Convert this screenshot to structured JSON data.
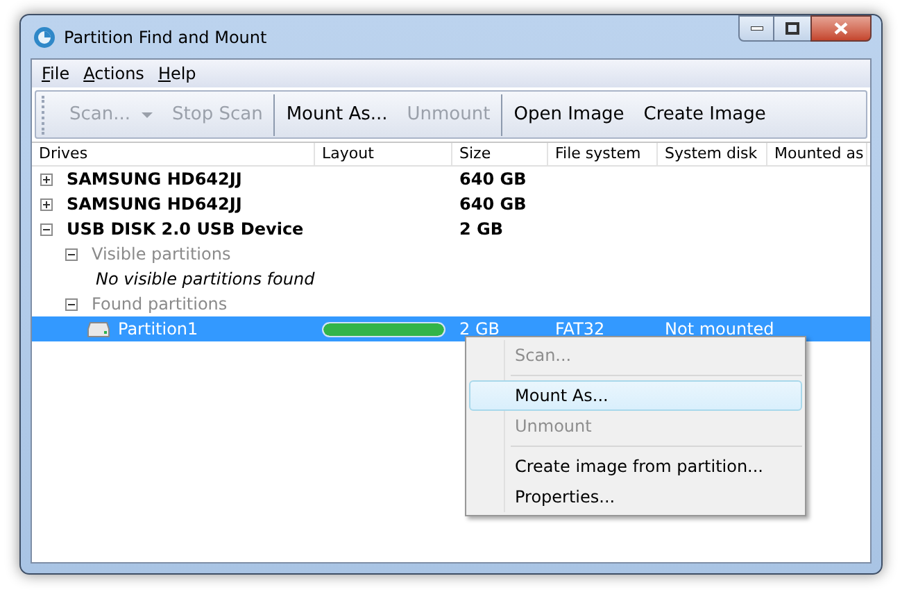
{
  "window": {
    "title": "Partition Find and Mount"
  },
  "menu": [
    {
      "label": "File"
    },
    {
      "label": "Actions"
    },
    {
      "label": "Help"
    }
  ],
  "toolbar": [
    [
      {
        "label": "Scan...",
        "disabled": true,
        "dropdown": true
      },
      {
        "label": "Stop Scan",
        "disabled": true,
        "dropdown": false
      }
    ],
    [
      {
        "label": "Mount As...",
        "disabled": false,
        "dropdown": false
      },
      {
        "label": "Unmount",
        "disabled": true,
        "dropdown": false
      }
    ],
    [
      {
        "label": "Open Image",
        "disabled": false,
        "dropdown": false
      },
      {
        "label": "Create Image",
        "disabled": false,
        "dropdown": false
      }
    ]
  ],
  "table": {
    "columns": [
      "Drives",
      "Layout",
      "Size",
      "File system",
      "System disk",
      "Mounted as"
    ],
    "rows": [
      {
        "kind": "drive",
        "name": "SAMSUNG HD642JJ",
        "size": "640 GB",
        "expanded": false,
        "selected": false
      },
      {
        "kind": "drive",
        "name": "SAMSUNG HD642JJ",
        "size": "640 GB",
        "expanded": false,
        "selected": false
      },
      {
        "kind": "drive",
        "name": "USB DISK 2.0 USB Device",
        "size": "2 GB",
        "expanded": true,
        "selected": false,
        "children": [
          {
            "kind": "group",
            "name": "Visible partitions",
            "expanded": true,
            "children": [
              {
                "kind": "message",
                "name": "No visible partitions found"
              }
            ]
          },
          {
            "kind": "group",
            "name": "Found partitions",
            "expanded": true,
            "children": [
              {
                "kind": "partition",
                "name": "Partition1",
                "level": 1,
                "size": "2 GB",
                "file_system": "FAT32",
                "system_disk": "Not mounted",
                "selected": true
              }
            ]
          }
        ]
      }
    ]
  },
  "context_menu": [
    [
      {
        "label": "Scan...",
        "disabled": true,
        "highlighted": false
      }
    ],
    [
      {
        "label": "Mount As...",
        "disabled": false,
        "highlighted": true
      },
      {
        "label": "Unmount",
        "disabled": true,
        "highlighted": false
      }
    ],
    [
      {
        "label": "Create image from partition...",
        "disabled": false,
        "highlighted": false
      },
      {
        "label": "Properties...",
        "disabled": false,
        "highlighted": false
      }
    ]
  ]
}
